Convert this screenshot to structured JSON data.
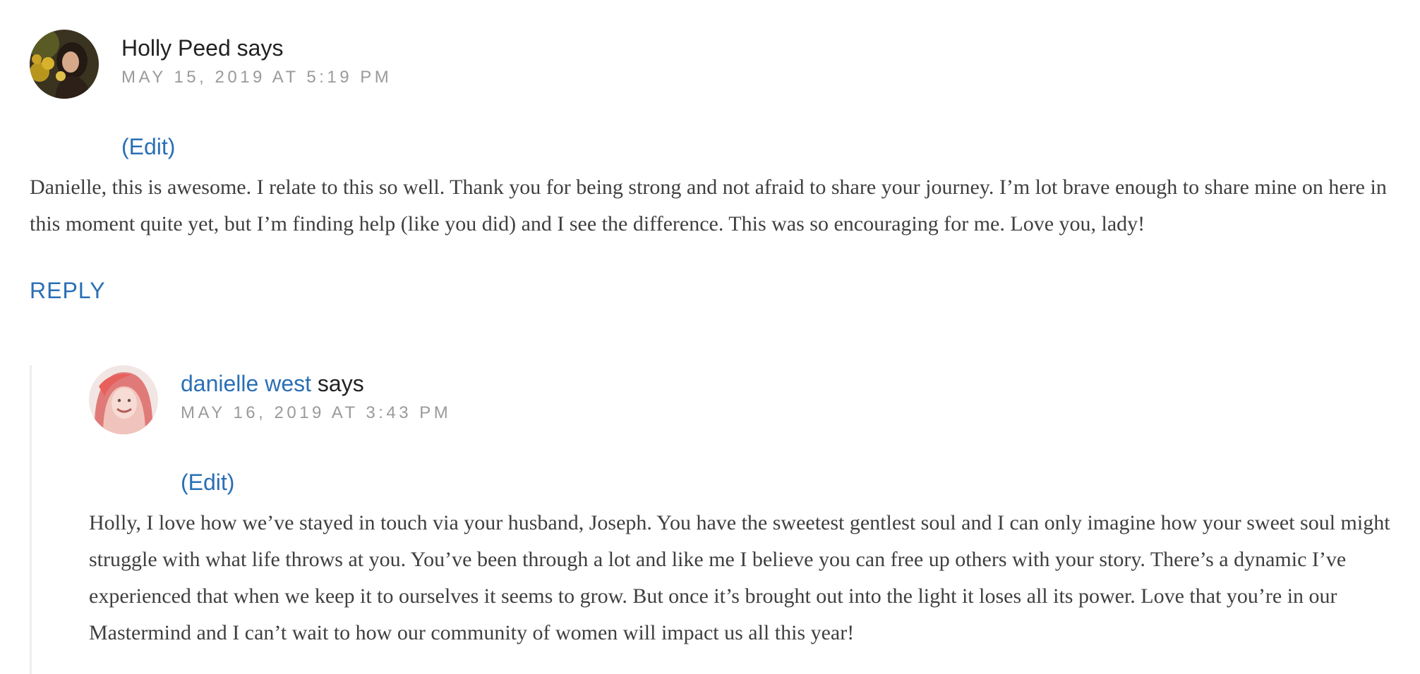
{
  "comments": [
    {
      "author": "Holly Peed",
      "says": "says",
      "date": "MAY 15, 2019 AT 5:19 PM",
      "edit_label": "(Edit)",
      "body": "Danielle, this is awesome. I relate to this so well. Thank you for being strong and not afraid to share your journey. I’m lot brave enough to share mine on here in this moment quite yet, but I’m finding help (like you did) and I see the difference. This was so encouraging for me. Love you, lady!",
      "reply_label": "REPLY"
    },
    {
      "author": "danielle west",
      "says": "says",
      "date": "MAY 16, 2019 AT 3:43 PM",
      "edit_label": "(Edit)",
      "body": "Holly, I love how we’ve stayed in touch via your husband, Joseph. You have the sweetest gentlest soul and I can only imagine how your sweet soul might struggle with what life throws at you. You’ve been through a lot and like me I believe you can free up others with your story. There’s a dynamic I’ve experienced that when we keep it to ourselves it seems to grow. But once it’s brought out into the light it loses all its power. Love that you’re in our Mastermind and I can’t wait to how our community of women will impact us all this year!"
    }
  ],
  "colors": {
    "link": "#2a6fb5",
    "date": "#9a9a9a",
    "body": "#3f3f3f",
    "thread_line": "#ededed"
  }
}
